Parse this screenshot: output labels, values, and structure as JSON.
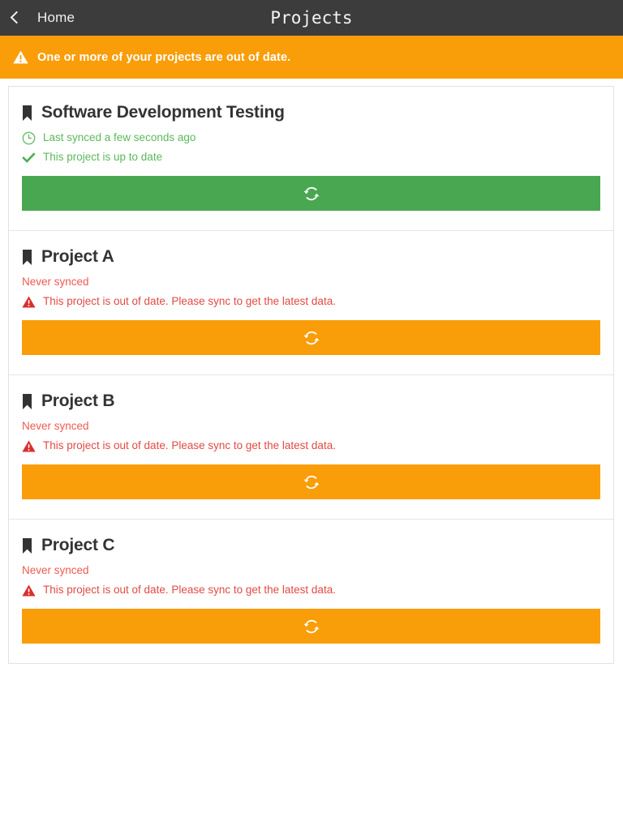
{
  "header": {
    "back_icon": "chevron-left-icon",
    "back_label": "Home",
    "title": "Projects"
  },
  "banner": {
    "icon": "warning-triangle-icon",
    "text": "One or more of your projects are out of date."
  },
  "colors": {
    "header_bg": "#3c3c3c",
    "warning_orange": "#f99d08",
    "success_green": "#4aa751",
    "green_text": "#5cb85c",
    "red_text": "#e24a43",
    "red_soft_text": "#ef5a52",
    "title_text": "#333333",
    "card_border": "#e2e2e2"
  },
  "projects": [
    {
      "icon": "bookmark-icon",
      "name": "Software Development Testing",
      "sync_icon": "clock-icon",
      "sync_status": "Last synced a few seconds ago",
      "state_icon": "check-icon",
      "state_message": "This project is up to date",
      "button_icon": "sync-refresh-icon",
      "button_state": "up-to-date"
    },
    {
      "icon": "bookmark-icon",
      "name": "Project A",
      "sync_icon": "",
      "sync_status": "Never synced",
      "state_icon": "warning-triangle-icon",
      "state_message": "This project is out of date. Please sync to get the latest data.",
      "button_icon": "sync-refresh-icon",
      "button_state": "out-of-date"
    },
    {
      "icon": "bookmark-icon",
      "name": "Project B",
      "sync_icon": "",
      "sync_status": "Never synced",
      "state_icon": "warning-triangle-icon",
      "state_message": "This project is out of date. Please sync to get the latest data.",
      "button_icon": "sync-refresh-icon",
      "button_state": "out-of-date"
    },
    {
      "icon": "bookmark-icon",
      "name": "Project C",
      "sync_icon": "",
      "sync_status": "Never synced",
      "state_icon": "warning-triangle-icon",
      "state_message": "This project is out of date. Please sync to get the latest data.",
      "button_icon": "sync-refresh-icon",
      "button_state": "out-of-date"
    }
  ]
}
